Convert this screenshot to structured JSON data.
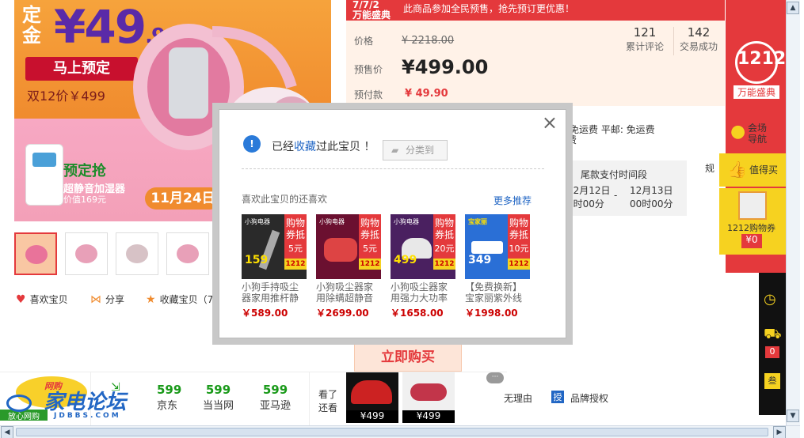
{
  "hero": {
    "dingjin": "定金",
    "price_main": "¥49",
    "price_dec": ".9",
    "preorder_btn": "马上预定",
    "double12_price": "双12价￥499",
    "humidifier_badge": "预定抢",
    "humidifier_name": "超静音加湿器",
    "humidifier_price": "价值169元",
    "date_pill": "11月24日"
  },
  "actions": {
    "like": "喜欢宝贝",
    "share": "分享",
    "collect": "收藏宝贝（71"
  },
  "promo_band": {
    "logo_line1": "7/7/2",
    "logo_line2": "万能盛典",
    "message": "此商品参加全民预售，抢先预订更优惠！"
  },
  "info": {
    "price_label": "价格",
    "price_value": "¥ 2218.00",
    "presale_label": "预售价",
    "presale_value": "¥499.00",
    "deposit_label": "预付款",
    "deposit_value": "¥ 49.90",
    "reviews_count": "121",
    "reviews_label": "累计评论",
    "deals_count": "142",
    "deals_label": "交易成功",
    "shipping": "免运费 平邮: 免运费",
    "shipping_tail": "费",
    "balance_label": "尾款支付时间段",
    "time_start_date": "12月12日",
    "time_start_time": "0时00分",
    "time_sep": "-",
    "time_end_date": "12月13日",
    "time_end_time": "00时00分",
    "spec_link": "规",
    "buy_now": "立即购买"
  },
  "sidebar": {
    "logo_line1": "1212",
    "logo_line2": "万能盛典",
    "venue": "会场\n导航",
    "worth_buy": "值得买",
    "coupon_label": "1212购物券",
    "coupon_value": "¥0",
    "cart_count": "0",
    "last_tab": "叁"
  },
  "bottom": {
    "compare": [
      {
        "price": "599",
        "store": "京东"
      },
      {
        "price": "599",
        "store": "当当网"
      },
      {
        "price": "599",
        "store": "亚马逊"
      }
    ],
    "also_viewed_1": "看了",
    "also_viewed_2": "还看",
    "mini_items": [
      {
        "price": "¥499"
      },
      {
        "price": "¥499"
      }
    ],
    "no_reason": "无理由",
    "brand_badge": "授",
    "brand_auth": "品牌授权",
    "badge_left_1": "网购",
    "badge_left_2": "放心网购",
    "watermark": "家电论坛",
    "watermark_sub": "JDBBS.COM"
  },
  "modal": {
    "collected_prefix": "已经",
    "collected_link": "收藏",
    "collected_suffix": "过此宝贝",
    "exclamation": "！",
    "category_btn": "分类到",
    "also_like": "喜欢此宝贝的还喜欢",
    "more": "更多推荐",
    "items": [
      {
        "name": "小狗手持吸尘器家用推杆静",
        "price": "￥589.00",
        "c1": "购物",
        "c2": "券抵",
        "c3": "5元",
        "bg": "#2a2a2a",
        "price_tag": "159",
        "top": "小狗电器"
      },
      {
        "name": "小狗吸尘器家用除螨超静音",
        "price": "￥2699.00",
        "c1": "购物",
        "c2": "券抵",
        "c3": "5元",
        "bg": "#6b1030",
        "price_tag": "",
        "top": "小狗电器"
      },
      {
        "name": "小狗吸尘器家用强力大功率",
        "price": "￥1658.00",
        "c1": "购物",
        "c2": "券抵",
        "c3": "20元",
        "bg": "#4a2060",
        "price_tag": "499",
        "top": "小狗电器"
      },
      {
        "name": "【免费换新】宝家丽紫外线",
        "price": "￥1998.00",
        "c1": "购物",
        "c2": "券抵",
        "c3": "10元",
        "bg": "#2a6fd6",
        "price_tag": "349",
        "top": "宝家丽"
      }
    ]
  },
  "colors": {
    "accent": "#e4393c",
    "link": "#2166c4",
    "price_red": "#cc0000",
    "yellow": "#f6d220"
  }
}
